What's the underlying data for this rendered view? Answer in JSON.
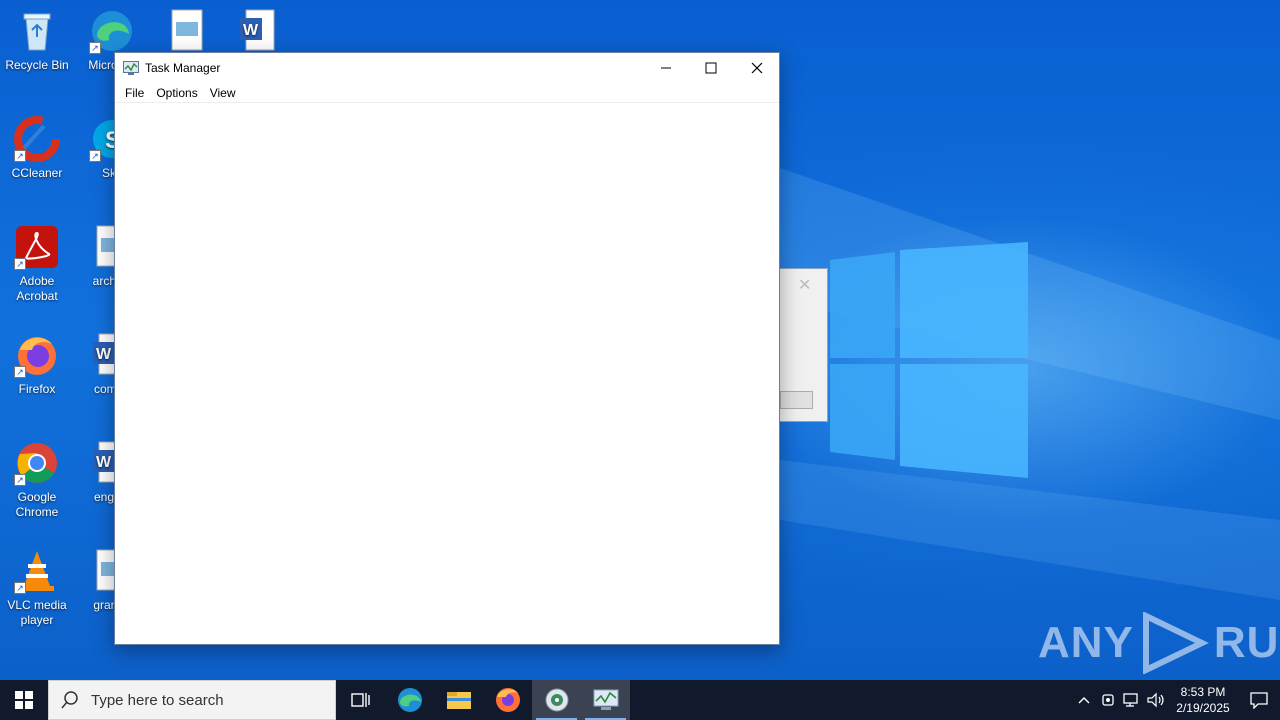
{
  "desktop": {
    "icons": [
      {
        "label": "Recycle Bin",
        "icon": "recycle-bin-icon"
      },
      {
        "label": "Micro Ed",
        "icon": "edge-icon"
      },
      {
        "label": "",
        "icon": "image-file-icon"
      },
      {
        "label": "",
        "icon": "word-doc-icon"
      },
      {
        "label": "CCleaner",
        "icon": "ccleaner-icon"
      },
      {
        "label": "Sky",
        "icon": "skype-icon"
      },
      {
        "label": "Adobe Acrobat",
        "icon": "acrobat-icon"
      },
      {
        "label": "archive",
        "icon": "image-file-icon"
      },
      {
        "label": "Firefox",
        "icon": "firefox-icon"
      },
      {
        "label": "compu",
        "icon": "word-doc-icon"
      },
      {
        "label": "Google Chrome",
        "icon": "chrome-icon"
      },
      {
        "label": "engine",
        "icon": "word-doc-icon"
      },
      {
        "label": "VLC media player",
        "icon": "vlc-icon"
      },
      {
        "label": "grandd",
        "icon": "image-file-icon"
      }
    ]
  },
  "task_manager": {
    "title": "Task Manager",
    "menu": [
      "File",
      "Options",
      "View"
    ]
  },
  "watermark": {
    "text_left": "ANY",
    "text_right": "RUN"
  },
  "taskbar": {
    "search_placeholder": "Type here to search",
    "apps": [
      "task-view-icon",
      "edge-icon",
      "file-explorer-icon",
      "firefox-icon",
      "installer-icon",
      "task-manager-icon"
    ],
    "clock_time": "8:53 PM",
    "clock_date": "2/19/2025"
  },
  "colors": {
    "desktop_blue": "#0a5fd0",
    "taskbar": "#101a2c",
    "window_border": "#6a7fa0"
  }
}
